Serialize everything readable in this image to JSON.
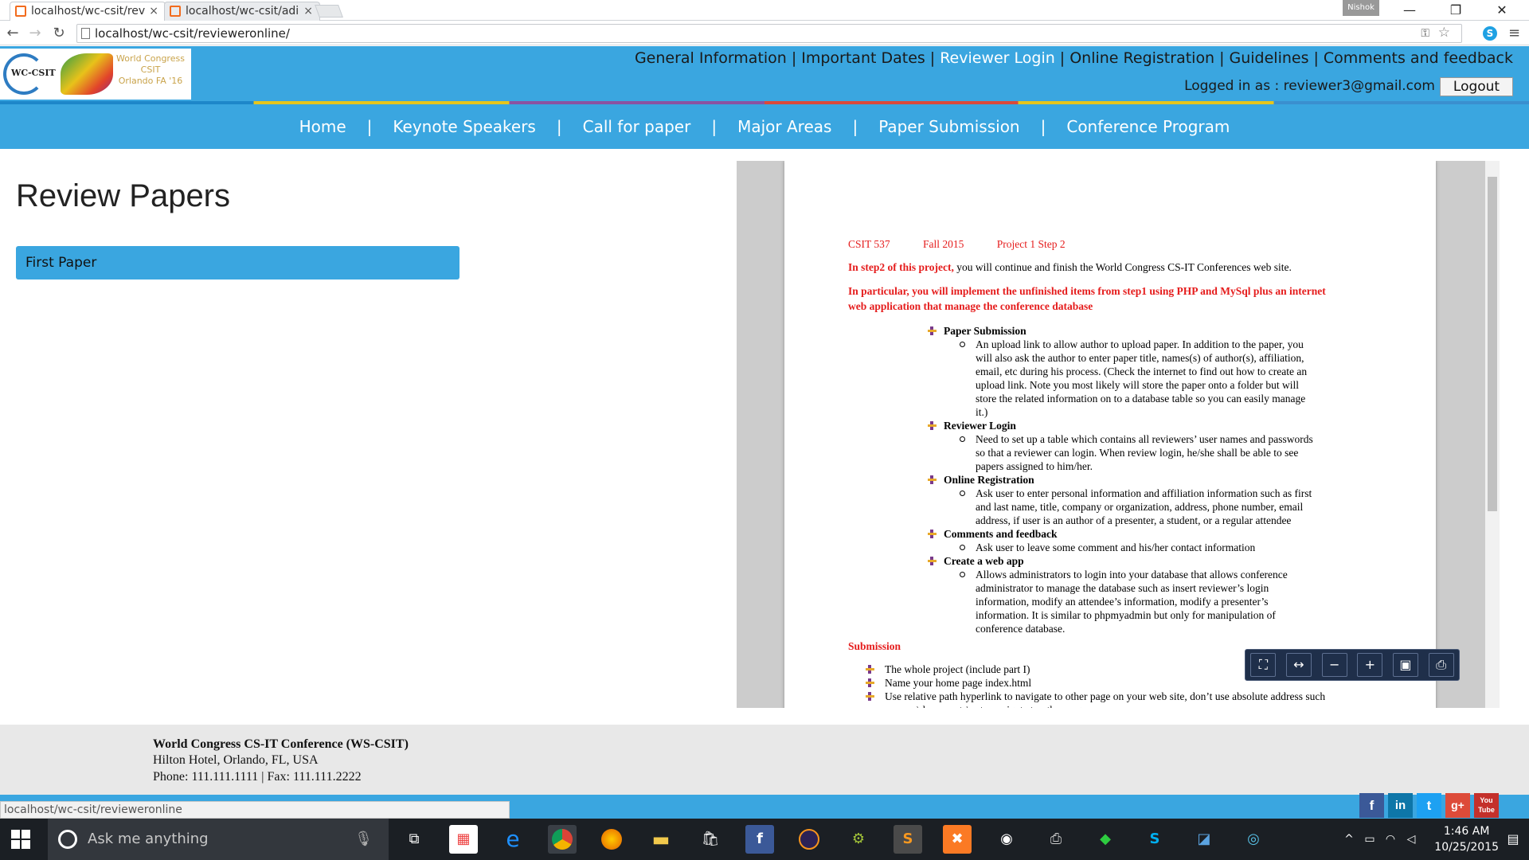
{
  "browser": {
    "tabs": [
      {
        "title": "localhost/wc-csit/rev",
        "close": "×"
      },
      {
        "title": "localhost/wc-csit/adi",
        "close": "×"
      }
    ],
    "profile_name": "Nishok",
    "address_url": "localhost/wc-csit/revieweronline/",
    "status_url": "localhost/wc-csit/revieweronline"
  },
  "site": {
    "logo": {
      "abbr": "WC-CSIT",
      "line1": "World Congress",
      "line2": "CSIT",
      "line3": "Orlando FA '16"
    },
    "top_nav": [
      "General Information",
      "Important Dates",
      "Reviewer Login",
      "Online Registration",
      "Guidelines",
      "Comments and feedback"
    ],
    "logged_in_text": "Logged in as : reviewer3@gmail.com",
    "logout_label": "Logout",
    "main_nav": [
      "Home",
      "Keynote Speakers",
      "Call for paper",
      "Major Areas",
      "Paper Submission",
      "Conference Program"
    ],
    "separator": "|"
  },
  "main": {
    "title": "Review Papers",
    "papers": [
      "First Paper"
    ]
  },
  "pdf": {
    "header_course": "CSIT 537",
    "header_term": "Fall 2015",
    "header_project": "Project 1 Step 2",
    "intro_red": "In step2 of this project,",
    "intro_rest": " you will continue and finish the World Congress CS-IT Conferences web site.",
    "particular_1": "In particular, you will implement the unfinished items from step1 using PHP and MySql plus an internet",
    "particular_2": "web application that manage the conference database",
    "items": [
      {
        "title": "Paper Submission",
        "lines": [
          "An upload link to allow author to upload paper. In addition to the paper, you",
          "will also ask the author to enter paper title, names(s) of author(s), affiliation,",
          "email, etc during his process. (Check the internet to find out how to create an",
          "upload link. Note you most likely will store the paper onto a folder but will",
          "store the related information on to a database table so you can easily manage",
          "it.)"
        ]
      },
      {
        "title": "Reviewer Login",
        "lines": [
          "Need to set up a table which contains all reviewers’ user names and passwords",
          "so that a reviewer can login. When review login, he/she shall be able to see",
          "papers assigned to him/her."
        ]
      },
      {
        "title": "Online Registration",
        "lines": [
          "Ask user to enter personal information and affiliation information such as first",
          "and last name, title, company or organization, address, phone number, email",
          "address, if user is an author of a presenter, a student, or a regular attendee"
        ]
      },
      {
        "title": "Comments and feedback",
        "lines": [
          "Ask user to leave some comment and his/her contact information"
        ]
      },
      {
        "title": "Create a web app",
        "lines": [
          "Allows administrators to login into your database that allows conference",
          "administrator to manage the database such as insert reviewer’s login",
          "information, modify an attendee’s information, modify a presenter’s",
          "information. It is similar to phpmyadmin but only for manipulation of",
          "conference database."
        ]
      }
    ],
    "submission_heading": "Submission",
    "submission_items": [
      "The whole project (include part I)",
      "Name your home page index.html",
      "Use relative path hyperlink to navigate to other page on your web site, don’t use absolute address such",
      "as c:\\documents\\... to navigate to other pages"
    ]
  },
  "footer": {
    "name": "World Congress CS-IT Conference (WS-CSIT)",
    "address": "Hilton Hotel, Orlando, FL, USA",
    "contact": "Phone: 111.111.1111 | Fax: 111.111.2222",
    "social": [
      "f",
      "in",
      "t",
      "g+",
      "You Tube"
    ]
  },
  "taskbar": {
    "search_placeholder": "Ask me anything",
    "time": "1:46 AM",
    "date": "10/25/2015"
  },
  "colors": {
    "brand_blue": "#3aa6e0",
    "pdf_red": "#e51c1c"
  }
}
